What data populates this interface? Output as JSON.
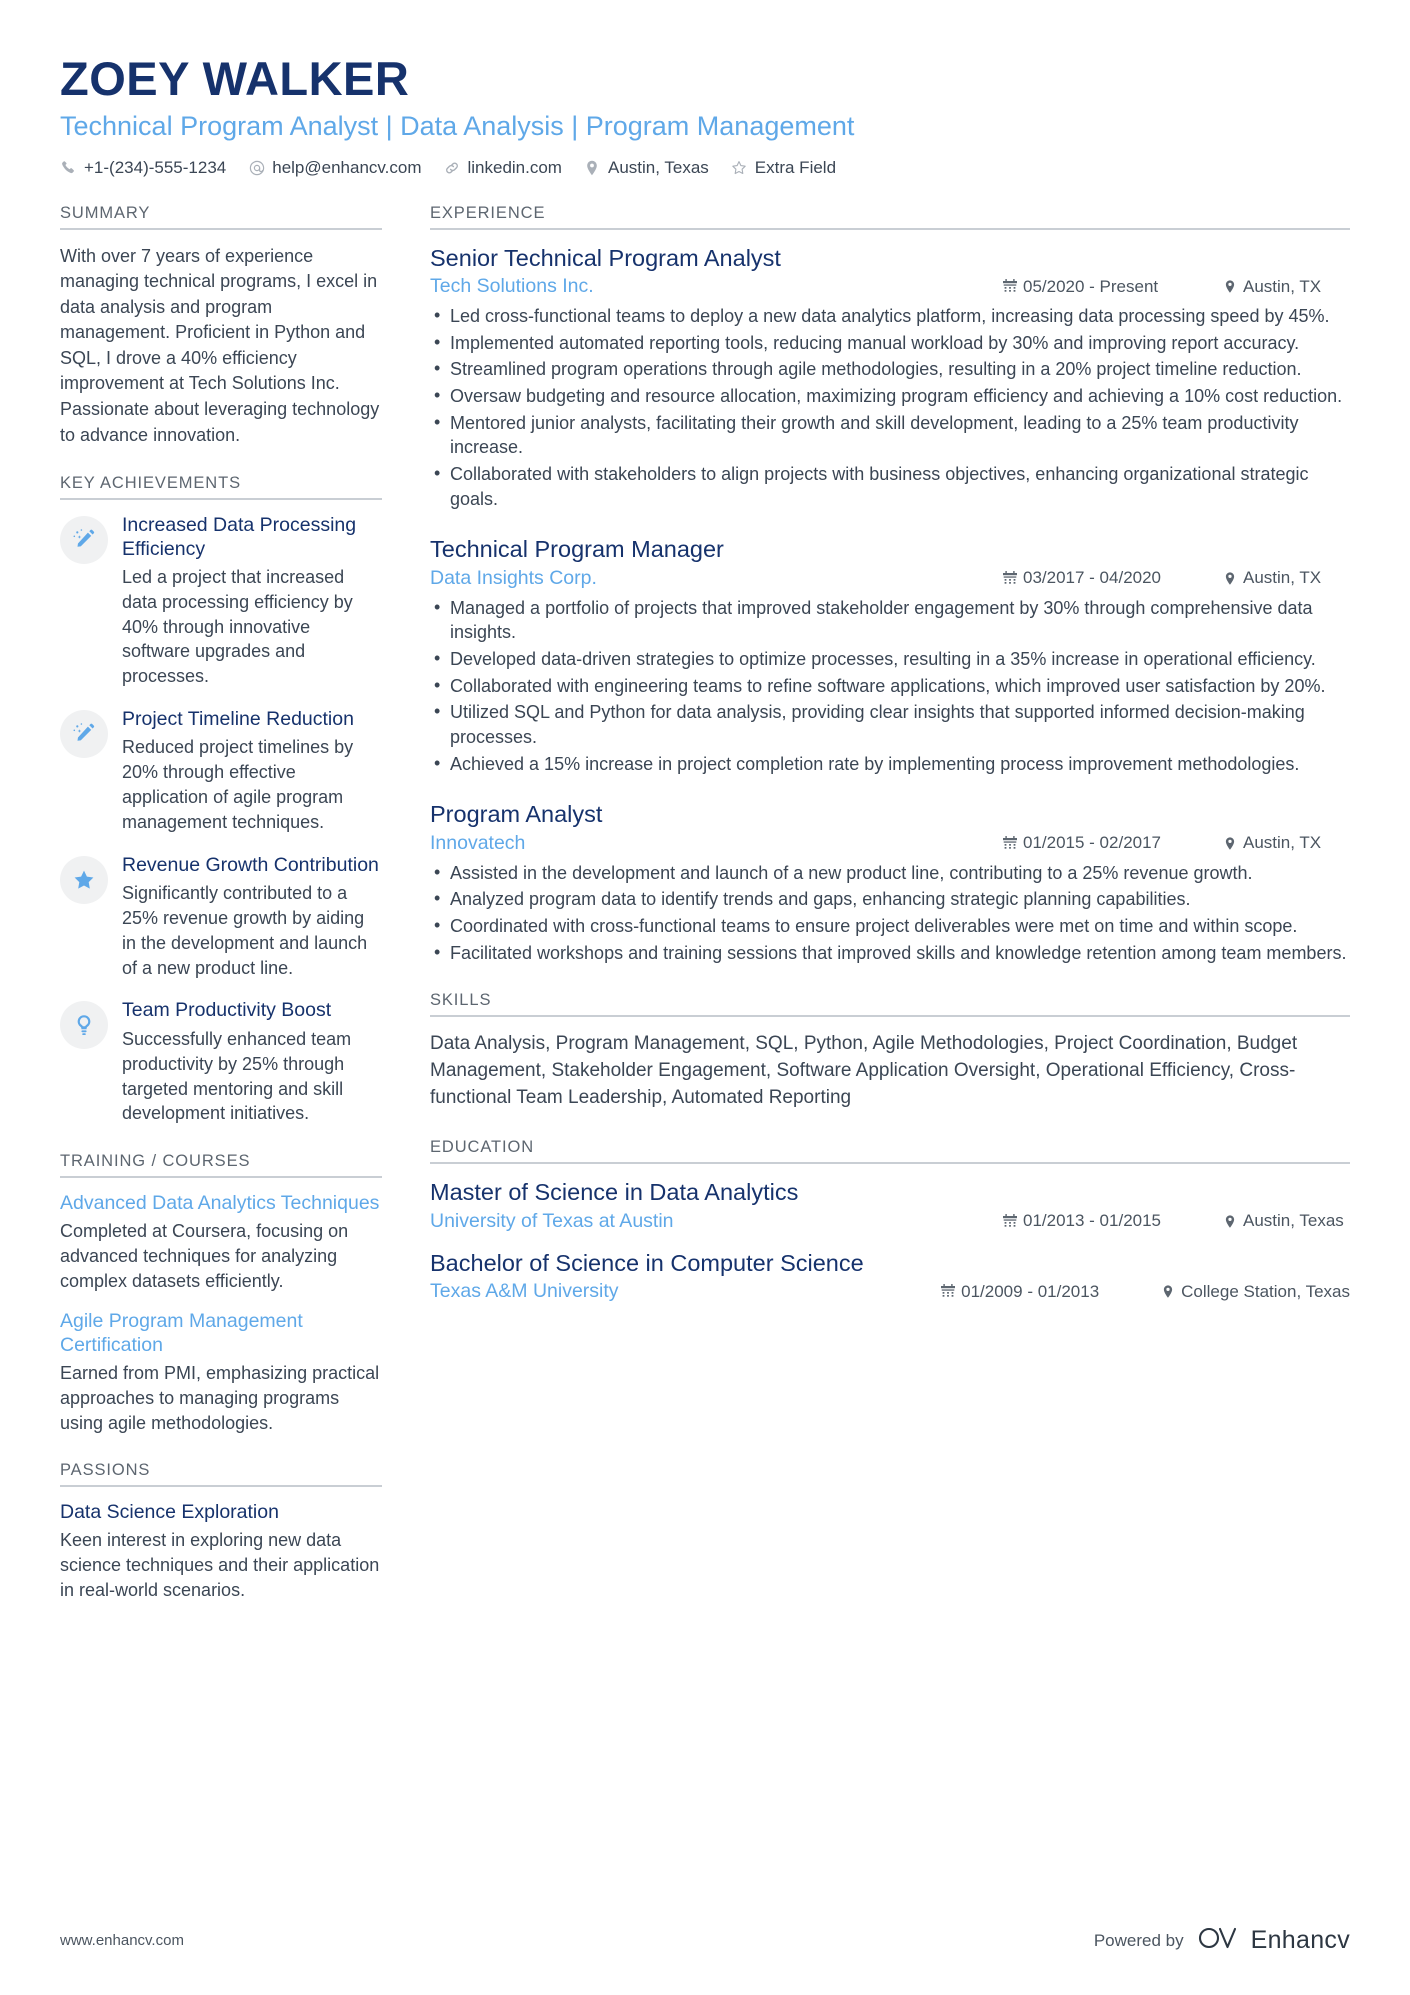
{
  "header": {
    "name": "ZOEY WALKER",
    "title": "Technical Program Analyst | Data Analysis | Program Management",
    "contacts": [
      {
        "icon": "phone-icon",
        "text": "+1-(234)-555-1234"
      },
      {
        "icon": "email-icon",
        "text": "help@enhancv.com"
      },
      {
        "icon": "link-icon",
        "text": "linkedin.com"
      },
      {
        "icon": "location-pin-icon",
        "text": "Austin, Texas"
      },
      {
        "icon": "star-outline-icon",
        "text": "Extra Field"
      }
    ]
  },
  "sidebar": {
    "summary": {
      "heading": "SUMMARY",
      "text": "With over 7 years of experience managing technical programs, I excel in data analysis and program management. Proficient in Python and SQL, I drove a 40% efficiency improvement at Tech Solutions Inc. Passionate about leveraging technology to advance innovation."
    },
    "key_achievements": {
      "heading": "KEY ACHIEVEMENTS",
      "items": [
        {
          "icon": "magic-wand-icon",
          "title": "Increased Data Processing Efficiency",
          "description": "Led a project that increased data processing efficiency by 40% through innovative software upgrades and processes."
        },
        {
          "icon": "magic-wand-icon",
          "title": "Project Timeline Reduction",
          "description": "Reduced project timelines by 20% through effective application of agile program management techniques."
        },
        {
          "icon": "star-filled-icon",
          "title": "Revenue Growth Contribution",
          "description": "Significantly contributed to a 25% revenue growth by aiding in the development and launch of a new product line."
        },
        {
          "icon": "lightbulb-icon",
          "title": "Team Productivity Boost",
          "description": "Successfully enhanced team productivity by 25% through targeted mentoring and skill development initiatives."
        }
      ]
    },
    "training": {
      "heading": "TRAINING / COURSES",
      "items": [
        {
          "title": "Advanced Data Analytics Techniques",
          "description": "Completed at Coursera, focusing on advanced techniques for analyzing complex datasets efficiently."
        },
        {
          "title": "Agile Program Management Certification",
          "description": "Earned from PMI, emphasizing practical approaches to managing programs using agile methodologies."
        }
      ]
    },
    "passions": {
      "heading": "PASSIONS",
      "items": [
        {
          "title": "Data Science Exploration",
          "description": "Keen interest in exploring new data science techniques and their application in real-world scenarios."
        }
      ]
    }
  },
  "main": {
    "experience": {
      "heading": "EXPERIENCE",
      "items": [
        {
          "role": "Senior Technical Program Analyst",
          "company": "Tech Solutions Inc.",
          "date": "05/2020 - Present",
          "location": "Austin, TX",
          "bullets": [
            "Led cross-functional teams to deploy a new data analytics platform, increasing data processing speed by 45%.",
            "Implemented automated reporting tools, reducing manual workload by 30% and improving report accuracy.",
            "Streamlined program operations through agile methodologies, resulting in a 20% project timeline reduction.",
            "Oversaw budgeting and resource allocation, maximizing program efficiency and achieving a 10% cost reduction.",
            "Mentored junior analysts, facilitating their growth and skill development, leading to a 25% team productivity increase.",
            "Collaborated with stakeholders to align projects with business objectives, enhancing organizational strategic goals."
          ]
        },
        {
          "role": "Technical Program Manager",
          "company": "Data Insights Corp.",
          "date": "03/2017 - 04/2020",
          "location": "Austin, TX",
          "bullets": [
            "Managed a portfolio of projects that improved stakeholder engagement by 30% through comprehensive data insights.",
            "Developed data-driven strategies to optimize processes, resulting in a 35% increase in operational efficiency.",
            "Collaborated with engineering teams to refine software applications, which improved user satisfaction by 20%.",
            "Utilized SQL and Python for data analysis, providing clear insights that supported informed decision-making processes.",
            "Achieved a 15% increase in project completion rate by implementing process improvement methodologies."
          ]
        },
        {
          "role": "Program Analyst",
          "company": "Innovatech",
          "date": "01/2015 - 02/2017",
          "location": "Austin, TX",
          "bullets": [
            "Assisted in the development and launch of a new product line, contributing to a 25% revenue growth.",
            "Analyzed program data to identify trends and gaps, enhancing strategic planning capabilities.",
            "Coordinated with cross-functional teams to ensure project deliverables were met on time and within scope.",
            "Facilitated workshops and training sessions that improved skills and knowledge retention among team members."
          ]
        }
      ]
    },
    "skills": {
      "heading": "SKILLS",
      "text": "Data Analysis, Program Management, SQL, Python, Agile Methodologies, Project Coordination, Budget Management, Stakeholder Engagement, Software Application Oversight, Operational Efficiency, Cross-functional Team Leadership, Automated Reporting"
    },
    "education": {
      "heading": "EDUCATION",
      "items": [
        {
          "degree": "Master of Science in Data Analytics",
          "school": "University of Texas at Austin",
          "date": "01/2013 - 01/2015",
          "location": "Austin, Texas"
        },
        {
          "degree": "Bachelor of Science in Computer Science",
          "school": "Texas A&M University",
          "date": "01/2009 - 01/2013",
          "location": "College Station, Texas"
        }
      ]
    }
  },
  "footer": {
    "url": "www.enhancv.com",
    "powered_by": "Powered by",
    "brand": "Enhancv"
  },
  "colors": {
    "navy": "#16326c",
    "accent_blue": "#5fa8e8",
    "body_text": "#3b4654",
    "muted": "#5d6670",
    "rule": "#c9ced4"
  }
}
